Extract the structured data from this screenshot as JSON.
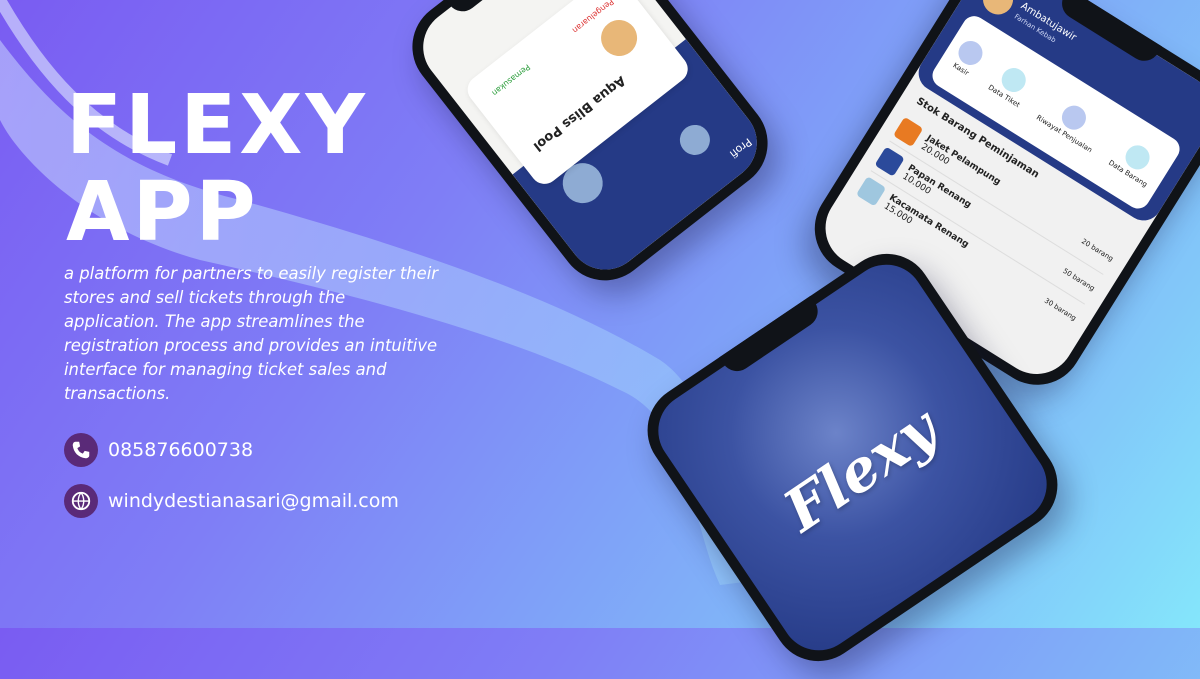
{
  "headline": {
    "line1": "FLEXY",
    "line2": "APP"
  },
  "description": "a platform for partners to easily register their stores and sell tickets through the application. The app streamlines the registration process and provides an intuitive interface for managing ticket sales and transactions.",
  "contacts": {
    "phone": {
      "icon": "phone-icon",
      "text": "085876600738"
    },
    "email": {
      "icon": "web-icon",
      "text": "windydestianasari@gmail.com"
    }
  },
  "phone_left": {
    "pool_name": "Aqua Bliss Pool",
    "pengeluaran": "Pengeluaran",
    "pemasukan": "Pemasukan",
    "tab_label": "Profi"
  },
  "phone_right": {
    "user_name": "Ambatujawir",
    "user_sub": "Farhan Kebab",
    "menu": [
      "Kasir",
      "Data Tiket",
      "Riwayat Penjualan",
      "Data Barang"
    ],
    "section_title": "Stok Barang Peminjaman",
    "items": [
      {
        "name": "Jaket Pelampung",
        "price": "20.000",
        "stock": "20 barang"
      },
      {
        "name": "Papan Renang",
        "price": "10.000",
        "stock": "50 barang"
      },
      {
        "name": "Kacamata Renang",
        "price": "15.000",
        "stock": "30 barang"
      }
    ]
  },
  "phone_center": {
    "logo": "Flexy"
  },
  "colors": {
    "accent_purple": "#5a2a78",
    "screen_blue": "#253a86"
  }
}
